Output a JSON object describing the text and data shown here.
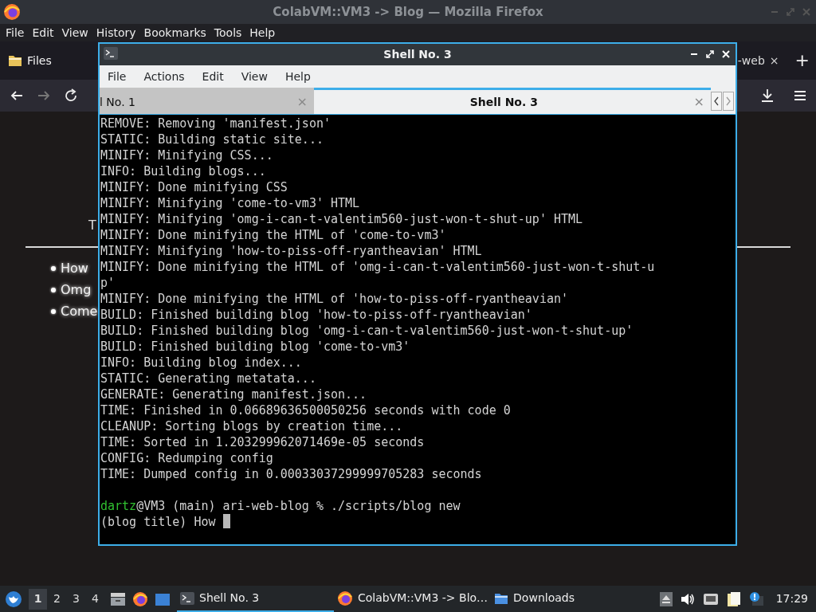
{
  "browser": {
    "title": "ColabVM::VM3 -> Blog — Mozilla Firefox",
    "menu": [
      "File",
      "Edit",
      "View",
      "History",
      "Bookmarks",
      "Tools",
      "Help"
    ],
    "tabs": [
      {
        "label": "Files"
      },
      {
        "label": "-web",
        "close": "×"
      }
    ],
    "new_tab": "+",
    "page": {
      "heading": "T",
      "items": [
        "How",
        "Omg",
        "Come"
      ]
    }
  },
  "terminal": {
    "title": "Shell No. 3",
    "menu": [
      "File",
      "Actions",
      "Edit",
      "View",
      "Help"
    ],
    "tabs": [
      {
        "label": "l No. 1",
        "selected": false,
        "close": "×"
      },
      {
        "label": "Shell No. 3",
        "selected": true,
        "close": "×"
      }
    ],
    "lines": [
      "REMOVE: Removing 'manifest.json'",
      "STATIC: Building static site...",
      "MINIFY: Minifying CSS...",
      "INFO: Building blogs...",
      "MINIFY: Done minifying CSS",
      "MINIFY: Minifying 'come-to-vm3' HTML",
      "MINIFY: Minifying 'omg-i-can-t-valentim560-just-won-t-shut-up' HTML",
      "MINIFY: Done minifying the HTML of 'come-to-vm3'",
      "MINIFY: Minifying 'how-to-piss-off-ryantheavian' HTML",
      "MINIFY: Done minifying the HTML of 'omg-i-can-t-valentim560-just-won-t-shut-u",
      "p'",
      "MINIFY: Done minifying the HTML of 'how-to-piss-off-ryantheavian'",
      "BUILD: Finished building blog 'how-to-piss-off-ryantheavian'",
      "BUILD: Finished building blog 'omg-i-can-t-valentim560-just-won-t-shut-up'",
      "BUILD: Finished building blog 'come-to-vm3'",
      "INFO: Building blog index...",
      "STATIC: Generating metatata...",
      "GENERATE: Generating manifest.json...",
      "TIME: Finished in 0.06689636500050256 seconds with code 0",
      "CLEANUP: Sorting blogs by creation time...",
      "TIME: Sorted in 1.203299962071469e-05 seconds",
      "CONFIG: Redumping config",
      "TIME: Dumped config in 0.00033037299999705283 seconds"
    ],
    "prompt": {
      "user": "dartz",
      "command": "@VM3 (main) ari-web-blog % ./scripts/blog new"
    },
    "input": "(blog title) How"
  },
  "taskbar": {
    "workspaces": [
      {
        "label": "1",
        "selected": true
      },
      {
        "label": "2",
        "selected": false
      },
      {
        "label": "3",
        "selected": false
      },
      {
        "label": "4",
        "selected": false
      }
    ],
    "tasks": [
      {
        "label": "Shell No. 3",
        "selected": true,
        "kind": "terminal"
      },
      {
        "label": "ColabVM::VM3 -> Blo…",
        "selected": false,
        "kind": "browser"
      },
      {
        "label": "Downloads",
        "selected": false,
        "kind": "folder"
      }
    ],
    "clock": "17:29"
  }
}
